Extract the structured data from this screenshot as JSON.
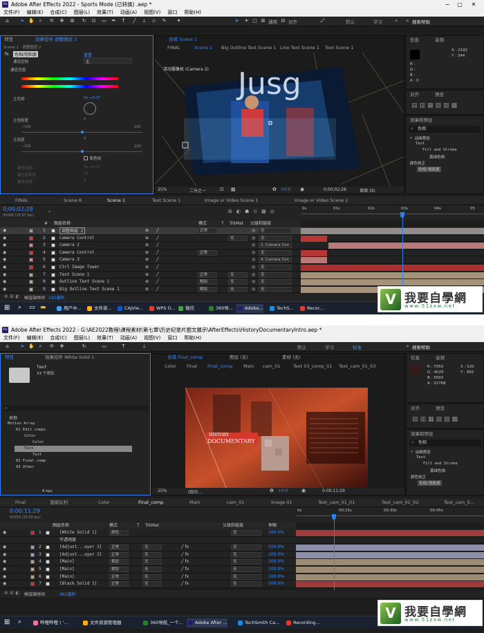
{
  "window1": {
    "title": "Adobe After Effects 2022 - Sports Mode (已转换) .aep *",
    "app_badge": "Ae",
    "window_controls": [
      "−",
      "▢",
      "✕"
    ],
    "menu": [
      "文件(F)",
      "编辑(E)",
      "合成(C)",
      "图层(L)",
      "效果(T)",
      "动画(A)",
      "视图(V)",
      "窗口",
      "帮助(H)"
    ],
    "toolbar": {
      "snap_label": "通用",
      "align_label": "对齐",
      "workspace_default": "默认",
      "workspace_learn": "学习",
      "search_placeholder": "搜索帮助"
    },
    "project_tab": "项目",
    "effects_tab": "效果控件 调整图层 2",
    "effects_subtitle": "Scene 1 · 调整图层 2",
    "effect_fx": "fx",
    "effect_name": "色相/饱和度",
    "effect_reset": "重置",
    "channel_control_label": "通道控制",
    "channel_control_value": "主",
    "channel_range_label": "通道范围",
    "master_hue_label": "主色相",
    "master_hue_value": "0x +0.0°",
    "master_saturation_label": "主饱和度",
    "master_saturation_value": "0",
    "sat_min": "−100",
    "sat_max": "100",
    "master_lightness_label": "主亮度",
    "master_lightness_value": "0",
    "light_min": "−100",
    "light_max": "100",
    "colorize_label": "彩色化",
    "colorize_hue_label": "着色色相",
    "colorize_sat_label": "着色饱和度",
    "colorize_light_label": "着色亮度",
    "colorize_hue_value": "0x +0.0°",
    "colorize_sat_value": "25",
    "colorize_light_value": "0",
    "comp_tab": "合成 Scene 1",
    "comp_crumbs": [
      "FINAL",
      "Scene 1",
      "Big Outline Text Scene 1",
      "Line Text Scene 1",
      "Text Scene 1"
    ],
    "camera_label": "活动摄像机 (Camera 2)",
    "viewer_zoom": "25%",
    "viewer_res": "二分之一",
    "viewer_exposure": "+0.0",
    "viewer_time": "0;00;02;28",
    "viewer_renderer": "草图 3D",
    "info_tab": "信息",
    "audio_tab": "音频",
    "info_x": "X : 2192",
    "info_y": "Y : 344",
    "info_r": "R : ",
    "info_g": "G : ",
    "info_b": "B : ",
    "info_a": "A : 0",
    "align_tab": "对齐",
    "preview_tab": "预览",
    "fx_presets_tab": "效果和预设",
    "fx_search_value": "色相",
    "fx_tree": [
      "* 动画预设",
      "Text",
      "Fill and Stroke",
      "黄绿色相",
      "颜色校正",
      "色相/饱和度"
    ],
    "tl_tabs": [
      "FINAL",
      "Scene 8",
      "Scene 1",
      "Text Scene 1",
      "Image or Video Scene 1",
      "Image or Video Scene 2"
    ],
    "tl_time": "0;00;02;28",
    "tl_fps": "00088 (29.97 fps)",
    "tl_headers": {
      "num": "#",
      "name": "图层名称",
      "mode": "模式",
      "t": "T",
      "trkmat": "TrkMat",
      "parent": "父级和链接"
    },
    "ruler": [
      "0s",
      "01s",
      "02s",
      "03s",
      "04s",
      "05"
    ],
    "layers": [
      {
        "num": "1",
        "name": "调整图层 2",
        "mode": "正常",
        "trk": "",
        "parent": "无",
        "color": "#a59c9c"
      },
      {
        "num": "2",
        "name": "Camera Control",
        "mode": "",
        "trk": "无",
        "parent": "无",
        "color": "#d13a3a"
      },
      {
        "num": "3",
        "name": "Camera 2",
        "mode": "",
        "trk": "",
        "parent": "2. Camera Con",
        "color": "#d48888"
      },
      {
        "num": "4",
        "name": "Camera Control",
        "mode": "正常",
        "trk": "",
        "parent": "无",
        "color": "#d13a3a"
      },
      {
        "num": "5",
        "name": "Camera 3",
        "mode": "",
        "trk": "",
        "parent": "4. Camera Con",
        "color": "#d48888"
      },
      {
        "num": "6",
        "name": "Ctrl Image Tower",
        "mode": "",
        "trk": "",
        "parent": "无",
        "color": "#c33333"
      },
      {
        "num": "7",
        "name": "Text Scene 1",
        "mode": "正常",
        "trk": "无",
        "parent": "无",
        "color": "#bba68a"
      },
      {
        "num": "8",
        "name": "Outline Text Scene 1",
        "mode": "相加",
        "trk": "无",
        "parent": "无",
        "color": "#bba68a"
      },
      {
        "num": "9",
        "name": "Big Outline Text Scene 1",
        "mode": "相加",
        "trk": "无",
        "parent": "无",
        "color": "#bba68a"
      }
    ],
    "footer_render": "帧渲染时间",
    "footer_ms": "145毫秒"
  },
  "taskbar1": [
    "用户中...",
    "文件资...",
    "CAJVie...",
    "WPS O...",
    "微信",
    "360导...",
    "Adobe...",
    "TechS...",
    "Recor..."
  ],
  "window2": {
    "title": "Adobe After Effects 2022 - G:\\AE2022教程\\课程素材\\第七章\\历史纪录片图文展示\\AfterEffects\\HistoryDocumentaryIntro.aep *",
    "menu": [
      "文件(F)",
      "编辑(E)",
      "合成(C)",
      "图层(L)",
      "效果(T)",
      "动画(A)",
      "视图(V)",
      "窗口",
      "帮助(H)"
    ],
    "toolbar": {
      "ws_default": "默认",
      "ws_learn": "学习",
      "ws_standard": "标准",
      "search_placeholder": "搜索帮助"
    },
    "project_tab": "项目",
    "effects_tab": "效果控件 White Solid 1",
    "project_item_name": "Text",
    "project_item_count": "33 个项目",
    "proj_col_name": "名称",
    "proj_tree": [
      "Motion Array",
      "01 Edit comps",
      "Color",
      "Color",
      "Text",
      "Text",
      "02 Final comp",
      "03 Other"
    ],
    "proj_bpc": "8 bpc",
    "comp_tab": "合成 Final_comp",
    "layer_tab": "图层 (无)",
    "footage_tab": "素材 (无)",
    "comp_crumbs": [
      "Color",
      "Final",
      "Final_comp",
      "Main",
      "cam_01",
      "Text 03_comp_01",
      "Text_cam_01_03"
    ],
    "history_text": "HISTORY",
    "documentary_text": "DOCUMENTARY",
    "viewer_zoom": "25%",
    "viewer_res": "(四分...",
    "viewer_exposure": "+0.0",
    "viewer_time": "0:00:11:29",
    "info_tab": "信息",
    "audio_tab": "音频",
    "info_r": "R : 7050",
    "info_g": "G : 4025",
    "info_b": "B : 5693",
    "info_a": "A : 32768",
    "info_x": "X : 520",
    "info_y": "Y : 992",
    "align_tab": "对齐",
    "preview_tab": "预览",
    "fx_presets_tab": "效果和预设",
    "fx_search_value": "色相",
    "fx_tree": [
      "* 动画预设",
      "Text",
      "Fill and Stroke",
      "黄绿色相",
      "颜色校正",
      "色相/饱和度"
    ],
    "tl_tabs": [
      "Final",
      "渲染队列",
      "Color",
      "Final_comp",
      "Main",
      "cam_01",
      "Image 01",
      "Text_cam_01_01",
      "Text_cam_01_02",
      "Text_cam_0..."
    ],
    "tl_time": "0:00:11:29",
    "tl_fps": "00359 (30.00 fps)",
    "tl_headers": {
      "name": "图层名称",
      "mode": "模式",
      "t": "T",
      "trkmat": "TrkMat",
      "parent": "父级和链接",
      "stretch": "伸缩"
    },
    "ruler": [
      "0s",
      "00:15s",
      "00:30s",
      "00:45s"
    ],
    "sub_row_label": "不透明度",
    "sub_row_value": "13%",
    "layers": [
      {
        "num": "1",
        "name": "[White Solid 1]",
        "mode": "颜色",
        "trk": "",
        "parent": "无",
        "stretch": "100.0%",
        "color": "#c33333",
        "bar": "#a03b3b"
      },
      {
        "num": "2",
        "name": "[Adjust...ayer 3]",
        "mode": "正常",
        "trk": "无",
        "parent": "无",
        "stretch": "100.0%",
        "color": "#9fa2b8",
        "bar": "#8c8fa7"
      },
      {
        "num": "3",
        "name": "[Adjust...ayer 2]",
        "mode": "正常",
        "trk": "无",
        "parent": "无",
        "stretch": "100.0%",
        "color": "#9fa2b8",
        "bar": "#8c8fa7"
      },
      {
        "num": "4",
        "name": "[Main]",
        "mode": "相加",
        "trk": "无",
        "parent": "无",
        "stretch": "100.0%",
        "color": "#bba68a",
        "bar": "#9d8c73"
      },
      {
        "num": "5",
        "name": "[Main]",
        "mode": "相加",
        "trk": "无",
        "parent": "无",
        "stretch": "100.0%",
        "color": "#bba68a",
        "bar": "#9d8c73"
      },
      {
        "num": "6",
        "name": "[Main]",
        "mode": "正常",
        "trk": "无",
        "parent": "无",
        "stretch": "100.0%",
        "color": "#bba68a",
        "bar": "#9d8c73"
      },
      {
        "num": "7",
        "name": "[Black Solid 1]",
        "mode": "正常",
        "trk": "无",
        "parent": "无",
        "stretch": "100.0%",
        "color": "#c33333",
        "bar": "#a03b3b"
      }
    ],
    "footer_render": "帧渲染时间",
    "footer_ms": "461毫秒"
  },
  "taskbar2": [
    "哔哩哔哩 ( '...",
    "文件资源管理器",
    "360导航_一个...",
    "Adobe After ...",
    "TechSmith Ca...",
    "Recording..."
  ],
  "watermark": {
    "char": "V",
    "cn": "我要自學網",
    "url": "www.51zxw.net"
  },
  "colors": {
    "accent": "#2f7df0",
    "panel": "#232323",
    "taskbar": "#1a2230"
  }
}
